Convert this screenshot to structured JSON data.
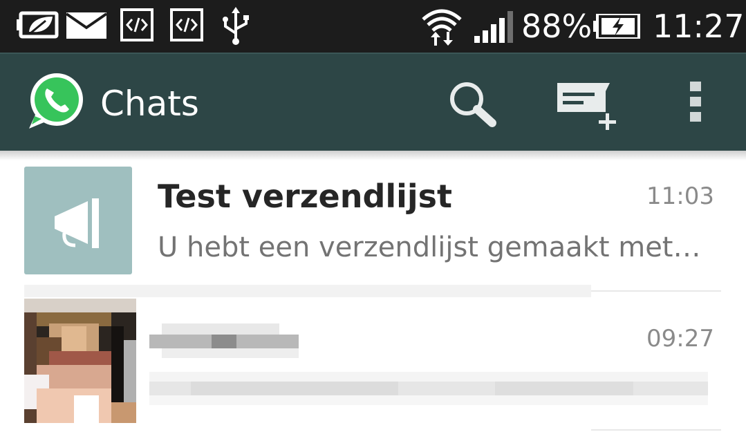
{
  "status_bar": {
    "battery_percent": "88%",
    "time": "11:27",
    "icons": [
      "eco-battery-icon",
      "email-icon",
      "code-icon",
      "code-icon",
      "usb-icon",
      "wifi-icon",
      "signal-icon",
      "battery-charging-icon"
    ]
  },
  "action_bar": {
    "title": "Chats",
    "logo_icon": "whatsapp-logo-icon",
    "actions": [
      "search-icon",
      "new-chat-icon",
      "overflow-menu-icon"
    ],
    "color": "#2d4646"
  },
  "chats": [
    {
      "name": "Test verzendlijst",
      "time": "11:03",
      "preview": "U hebt een verzendlijst gemaakt met…",
      "avatar_icon": "broadcast-megaphone-icon",
      "avatar_color": "#9fbfbf"
    },
    {
      "name": "",
      "time": "09:27",
      "preview": "",
      "avatar_icon": "pixelated-photo-avatar"
    }
  ]
}
